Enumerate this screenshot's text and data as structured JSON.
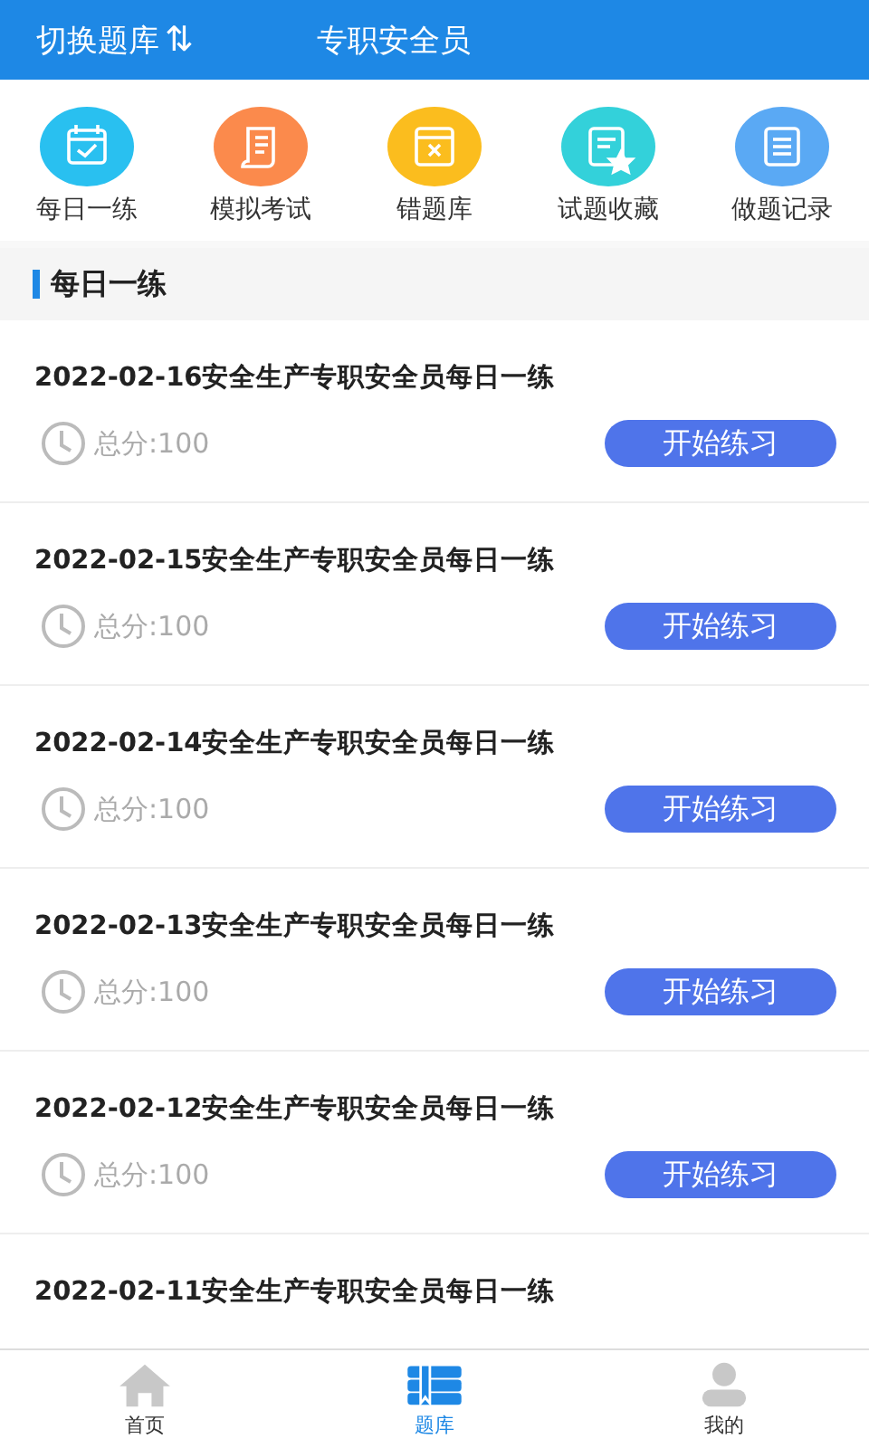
{
  "header": {
    "switch_label": "切换题库",
    "switch_icon": "⇅",
    "title": "专职安全员"
  },
  "shortcuts": [
    {
      "label": "每日一练",
      "kind": "calendar",
      "color": "#29c0f0"
    },
    {
      "label": "模拟考试",
      "kind": "scroll",
      "color": "#fb8a4c"
    },
    {
      "label": "错题库",
      "kind": "book",
      "color": "#fbbd1e"
    },
    {
      "label": "试题收藏",
      "kind": "favorite",
      "color": "#33d1da"
    },
    {
      "label": "做题记录",
      "kind": "list",
      "color": "#5aa9f4"
    }
  ],
  "section": {
    "title": "每日一练"
  },
  "items": [
    {
      "title": "2022-02-16安全生产专职安全员每日一练",
      "score": "总分:100",
      "button": "开始练习"
    },
    {
      "title": "2022-02-15安全生产专职安全员每日一练",
      "score": "总分:100",
      "button": "开始练习"
    },
    {
      "title": "2022-02-14安全生产专职安全员每日一练",
      "score": "总分:100",
      "button": "开始练习"
    },
    {
      "title": "2022-02-13安全生产专职安全员每日一练",
      "score": "总分:100",
      "button": "开始练习"
    },
    {
      "title": "2022-02-12安全生产专职安全员每日一练",
      "score": "总分:100",
      "button": "开始练习"
    },
    {
      "title": "2022-02-11安全生产专职安全员每日一练"
    }
  ],
  "tabs": [
    {
      "label": "首页",
      "kind": "home",
      "selected": false
    },
    {
      "label": "题库",
      "kind": "bank",
      "selected": true
    },
    {
      "label": "我的",
      "kind": "user",
      "selected": false
    }
  ]
}
